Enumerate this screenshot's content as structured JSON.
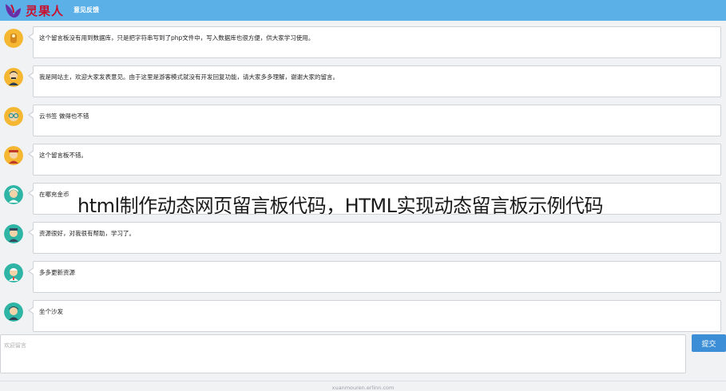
{
  "header": {
    "logo_text": "灵果人",
    "nav_label": "意见反馈",
    "colors": {
      "bar": "#5bb0e8",
      "logo": "#c8102e"
    }
  },
  "messages": [
    {
      "avatar": "avatar-icon",
      "text": "这个留言板没有用到数据库，只是把字符串写到了php文件中，写入数据库也很方便，供大家学习使用。"
    },
    {
      "avatar": "avatar-icon",
      "text": "我是网站主，欢迎大家发表意见。由于这里是游客模式就没有开发回复功能，请大家多多理解，谢谢大家的留言。"
    },
    {
      "avatar": "avatar-icon",
      "text": "云书签 做得也不错"
    },
    {
      "avatar": "avatar-icon",
      "text": "这个留言板不错。"
    },
    {
      "avatar": "avatar-icon",
      "text": "在哪充金币"
    },
    {
      "avatar": "avatar-icon",
      "text": "资源很好，对我很有帮助，学习了。"
    },
    {
      "avatar": "avatar-icon",
      "text": "多多更新资源"
    },
    {
      "avatar": "avatar-icon",
      "text": "坐个沙发"
    }
  ],
  "overlay_title": "html制作动态网页留言板代码，HTML实现动态留言板示例代码",
  "composer": {
    "placeholder": "欢迎留言",
    "submit_label": "提交"
  },
  "footer": {
    "watermark": "xuanmouren.erlinn.com"
  }
}
